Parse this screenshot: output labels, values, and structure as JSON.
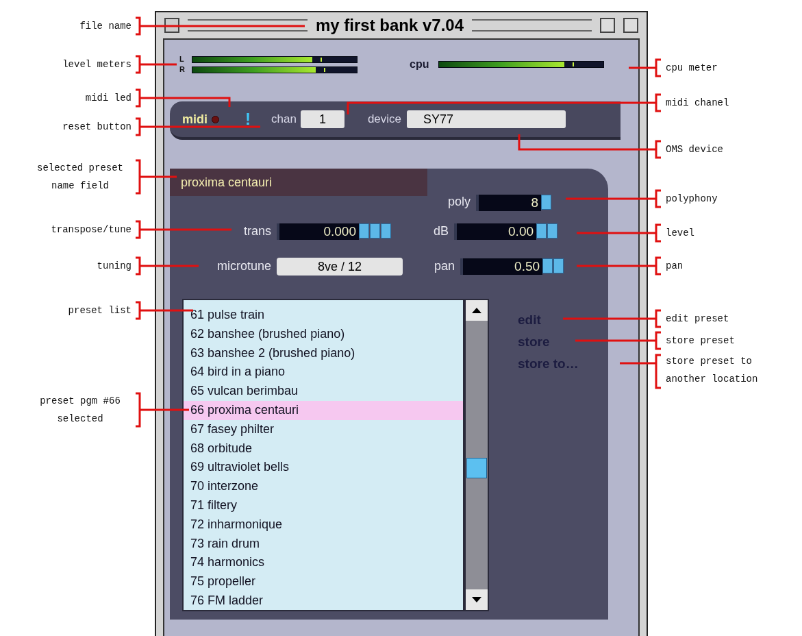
{
  "window": {
    "title": "my first bank v7.04"
  },
  "meters": {
    "channels": [
      {
        "label": "L",
        "level": 0.73
      },
      {
        "label": "R",
        "level": 0.75
      }
    ],
    "cpu": {
      "label": "cpu",
      "level": 0.76
    }
  },
  "midi": {
    "label": "midi",
    "reset": "!",
    "chan_label": "chan",
    "chan": "1",
    "device_label": "device",
    "device": "SY77"
  },
  "preset": {
    "name": "proxima centauri",
    "poly": {
      "label": "poly",
      "value": "8"
    },
    "trans": {
      "label": "trans",
      "value": "0.000"
    },
    "db": {
      "label": "dB",
      "value": "0.00"
    },
    "microtune": {
      "label": "microtune",
      "value": "8ve / 12"
    },
    "pan": {
      "label": "pan",
      "value": "0.50"
    }
  },
  "list": {
    "items": [
      {
        "text": "61 pulse train",
        "selected": false
      },
      {
        "text": "62 banshee (brushed piano)",
        "selected": false
      },
      {
        "text": "63 banshee 2 (brushed piano)",
        "selected": false
      },
      {
        "text": "64 bird in a piano",
        "selected": false
      },
      {
        "text": "65 vulcan berimbau",
        "selected": false
      },
      {
        "text": "66 proxima centauri",
        "selected": true
      },
      {
        "text": "67 fasey philter",
        "selected": false
      },
      {
        "text": "68 orbitude",
        "selected": false
      },
      {
        "text": "69 ultraviolet bells",
        "selected": false
      },
      {
        "text": "70 interzone",
        "selected": false
      },
      {
        "text": "71 filtery",
        "selected": false
      },
      {
        "text": "72 inharmonique",
        "selected": false
      },
      {
        "text": "73 rain drum",
        "selected": false
      },
      {
        "text": "74 harmonics",
        "selected": false
      },
      {
        "text": "75 propeller",
        "selected": false
      },
      {
        "text": "76 FM ladder",
        "selected": false
      }
    ]
  },
  "actions": [
    "edit",
    "store",
    "store to…"
  ],
  "annotations": {
    "left": [
      "file name",
      "level meters",
      "midi led",
      "reset button",
      "selected preset name field",
      "transpose/tune",
      "tuning",
      "preset list",
      "preset pgm #66 selected"
    ],
    "right": [
      "cpu meter",
      "midi chanel",
      "OMS device",
      "polyphony",
      "level",
      "pan",
      "edit preset",
      "store preset",
      "store preset to another location"
    ]
  }
}
